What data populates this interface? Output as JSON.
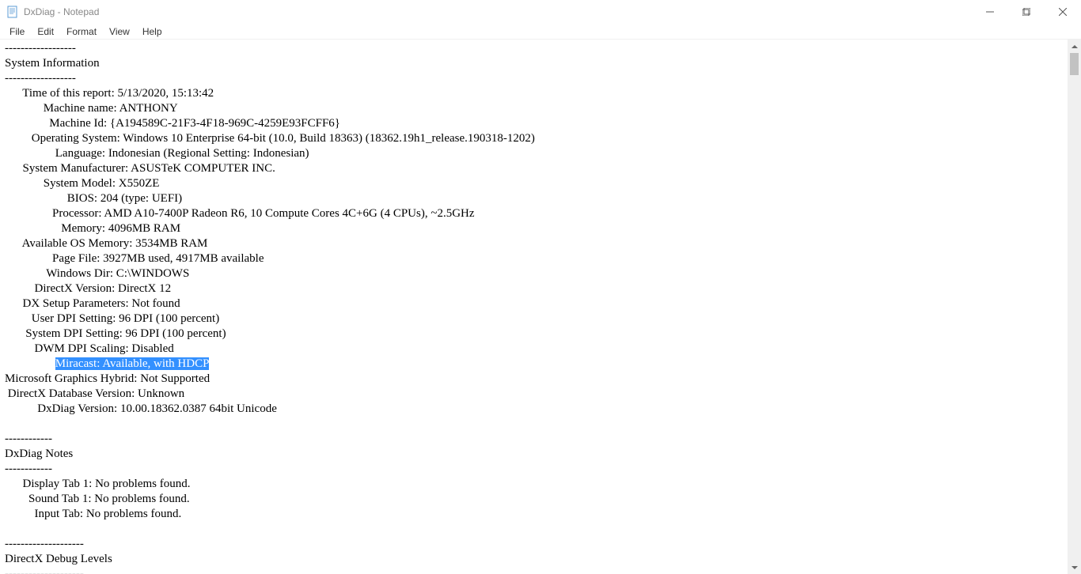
{
  "window": {
    "title": "DxDiag - Notepad"
  },
  "menu": {
    "file": "File",
    "edit": "Edit",
    "format": "Format",
    "view": "View",
    "help": "Help"
  },
  "doc": {
    "sep_long": "------------------",
    "section1_title": "System Information",
    "lines": {
      "time_label": "      Time of this report:",
      "time_val": " 5/13/2020, 15:13:42",
      "machine_name_label": "             Machine name:",
      "machine_name_val": " ANTHONY",
      "machine_id_label": "               Machine Id:",
      "machine_id_val": " {A194589C-21F3-4F18-969C-4259E93FCFF6}",
      "os_label": "         Operating System:",
      "os_val": " Windows 10 Enterprise 64-bit (10.0, Build 18363) (18362.19h1_release.190318-1202)",
      "lang_label": "                 Language:",
      "lang_val": " Indonesian (Regional Setting: Indonesian)",
      "mfr_label": "      System Manufacturer:",
      "mfr_val": " ASUSTeK COMPUTER INC.",
      "model_label": "             System Model:",
      "model_val": " X550ZE",
      "bios_label": "                     BIOS:",
      "bios_val": " 204 (type: UEFI)",
      "proc_label": "                Processor:",
      "proc_val": " AMD A10-7400P Radeon R6, 10 Compute Cores 4C+6G (4 CPUs), ~2.5GHz",
      "mem_label": "                   Memory:",
      "mem_val": " 4096MB RAM",
      "avail_label": "      Available OS Memory:",
      "avail_val": " 3534MB RAM",
      "page_label": "                Page File:",
      "page_val": " 3927MB used, 4917MB available",
      "windir_label": "              Windows Dir:",
      "windir_val": " C:\\WINDOWS",
      "dxver_label": "          DirectX Version:",
      "dxver_val": " DirectX 12",
      "dxsetup_label": "      DX Setup Parameters:",
      "dxsetup_val": " Not found",
      "userdpi_label": "         User DPI Setting:",
      "userdpi_val": " 96 DPI (100 percent)",
      "sysdpi_label": "       System DPI Setting:",
      "sysdpi_val": " 96 DPI (100 percent)",
      "dwm_label": "          DWM DPI Scaling:",
      "dwm_val": " Disabled",
      "miracast_pad": "                 ",
      "miracast_text": "Miracast: Available, with HDCP",
      "mshybrid_label": "Microsoft Graphics Hybrid:",
      "mshybrid_val": " Not Supported",
      "dxdb_label": " DirectX Database Version:",
      "dxdb_val": " Unknown",
      "dxdiagver_label": "           DxDiag Version:",
      "dxdiagver_val": " 10.00.18362.0387 64bit Unicode"
    },
    "sep_short": "------------",
    "section2_title": "DxDiag Notes",
    "notes": {
      "display_label": "      Display Tab 1:",
      "display_val": " No problems found.",
      "sound_label": "        Sound Tab 1:",
      "sound_val": " No problems found.",
      "input_label": "          Input Tab:",
      "input_val": " No problems found."
    },
    "sep_debug": "--------------------",
    "section3_title": "DirectX Debug Levels",
    "sep_debug2": "--------------------"
  }
}
